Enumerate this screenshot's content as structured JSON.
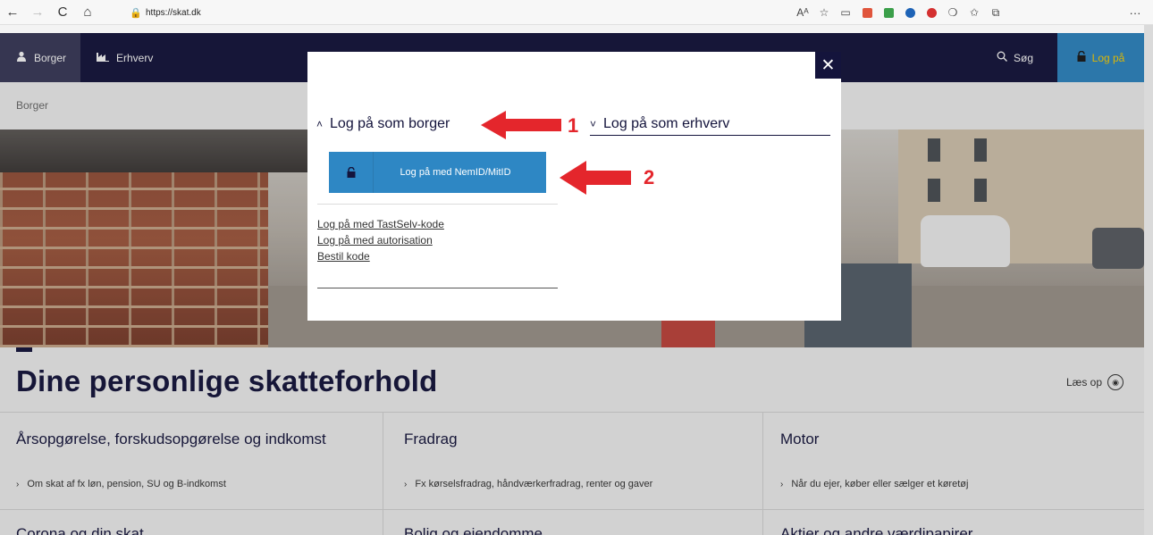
{
  "browser": {
    "url": "https://skat.dk",
    "back_glyph": "←",
    "forward_glyph": "→",
    "refresh_glyph": "C",
    "home_glyph": "⌂",
    "lock_glyph": "🔒",
    "more_glyph": "···",
    "extensions": [
      {
        "name": "read-aloud-icon",
        "glyph": "Aᴬ"
      },
      {
        "name": "favorite-add-icon",
        "glyph": "☆"
      },
      {
        "name": "screenshot-icon",
        "glyph": "▭"
      },
      {
        "name": "ext-red-icon",
        "color": "#e0553c",
        "shape": "sq"
      },
      {
        "name": "ext-green-icon",
        "color": "#3b9f4a",
        "shape": "sq"
      },
      {
        "name": "ext-blue-icon",
        "color": "#1e63b6",
        "shape": "circle"
      },
      {
        "name": "adblock-icon",
        "color": "#d43030",
        "shape": "circle"
      },
      {
        "name": "extensions-icon",
        "glyph": "❍"
      },
      {
        "name": "favorites-icon",
        "glyph": "✩"
      },
      {
        "name": "collections-icon",
        "glyph": "⧉"
      }
    ]
  },
  "header": {
    "borger": "Borger",
    "erhverv": "Erhverv",
    "search": "Søg",
    "login": "Log på"
  },
  "breadcrumb": "Borger",
  "page": {
    "title": "Dine personlige skatteforhold",
    "read_aloud": "Læs op"
  },
  "cards": [
    {
      "title": "Årsopgørelse, forskudsopgørelse og indkomst",
      "link": "Om skat af fx løn, pension, SU og B-indkomst"
    },
    {
      "title": "Fradrag",
      "link": "Fx kørselsfradrag, håndværkerfradrag, renter og gaver"
    },
    {
      "title": "Motor",
      "link": "Når du ejer, køber eller sælger et køretøj"
    }
  ],
  "next_cards": [
    "Corona og din skat",
    "Bolig og ejendomme",
    "Aktier og andre værdipapirer"
  ],
  "modal": {
    "close": "✕",
    "borger_heading": "Log på som borger",
    "erhverv_heading": "Log på som erhverv",
    "nemid_button": "Log på med NemID/MitID",
    "links": [
      "Log på med TastSelv-kode",
      "Log på med autorisation",
      "Bestil kode"
    ]
  },
  "annotations": {
    "one": "1",
    "two": "2",
    "color": "#e4262c"
  },
  "colors": {
    "navy": "#14143c",
    "blue": "#2e87c4",
    "yellow": "#ffd200"
  }
}
